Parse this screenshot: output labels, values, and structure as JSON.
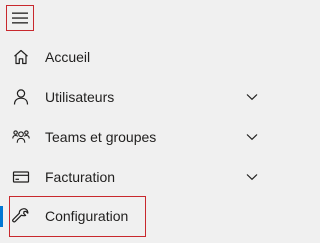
{
  "nav": {
    "menu_toggle_icon": "hamburger-icon",
    "items": [
      {
        "label": "Accueil",
        "icon": "home-icon",
        "expandable": false
      },
      {
        "label": "Utilisateurs",
        "icon": "person-icon",
        "expandable": true
      },
      {
        "label": "Teams et groupes",
        "icon": "people-group-icon",
        "expandable": true
      },
      {
        "label": "Facturation",
        "icon": "credit-card-icon",
        "expandable": true
      },
      {
        "label": "Configuration",
        "icon": "wrench-icon",
        "expandable": false,
        "active": true
      }
    ]
  },
  "colors": {
    "background": "#f0f0f0",
    "text": "#201f1e",
    "active_indicator": "#0078d4",
    "highlight_border": "#c8282d"
  }
}
